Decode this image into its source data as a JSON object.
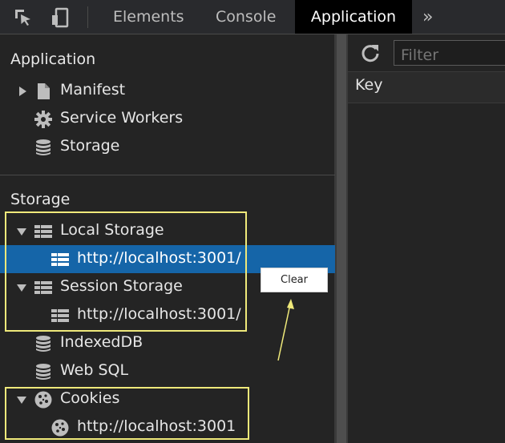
{
  "toolbar": {
    "tabs": [
      {
        "label": "Elements"
      },
      {
        "label": "Console"
      },
      {
        "label": "Application"
      }
    ],
    "more_label": "»"
  },
  "sidebar": {
    "application_title": "Application",
    "app_items": [
      {
        "label": "Manifest",
        "icon": "file-icon"
      },
      {
        "label": "Service Workers",
        "icon": "gear-icon"
      },
      {
        "label": "Storage",
        "icon": "database-icon"
      }
    ],
    "storage_title": "Storage",
    "storage_items": [
      {
        "label": "Local Storage",
        "icon": "table-grid-icon"
      },
      {
        "label": "http://localhost:3001/",
        "icon": "table-grid-icon",
        "selected": true
      },
      {
        "label": "Session Storage",
        "icon": "table-grid-icon"
      },
      {
        "label": "http://localhost:3001/",
        "icon": "table-grid-icon"
      },
      {
        "label": "IndexedDB",
        "icon": "database-icon"
      },
      {
        "label": "Web SQL",
        "icon": "database-icon"
      },
      {
        "label": "Cookies",
        "icon": "cookie-icon"
      },
      {
        "label": "http://localhost:3001",
        "icon": "cookie-icon"
      }
    ]
  },
  "panel": {
    "filter_placeholder": "Filter",
    "key_header": "Key"
  },
  "context_menu": {
    "clear_label": "Clear"
  },
  "colors": {
    "selection": "#1565a8",
    "highlight_box": "#efe97a",
    "active_tab_bg": "#000000"
  }
}
